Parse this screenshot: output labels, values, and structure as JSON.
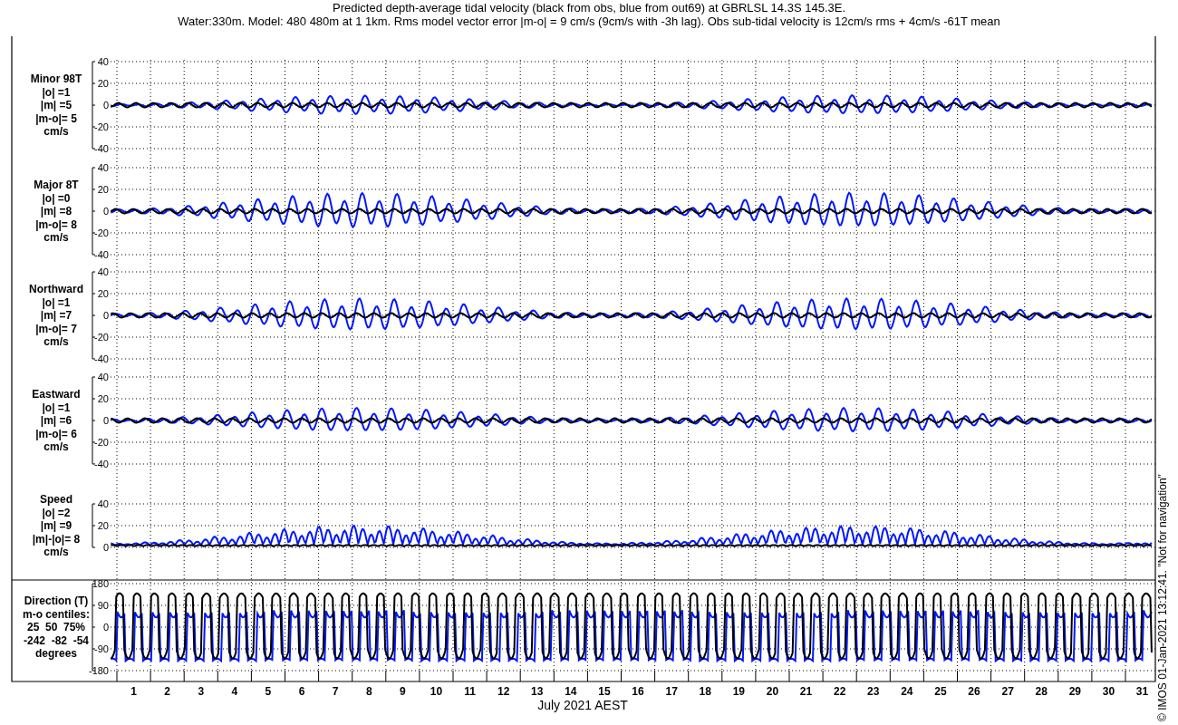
{
  "title": [
    "Predicted depth-average tidal velocity (black from obs, blue from out69) at GBRLSL 14.3S 145.3E.",
    "Water:330m. Model: 480 480m at 1 1km. Rms model vector error |m-o| = 9 cm/s (9cm/s with -3h lag). Obs sub-tidal velocity is 12cm/s rms + 4cm/s -61T mean"
  ],
  "panels": [
    {
      "kind": "velocity",
      "label": [
        "Minor 98T",
        "|o| =1",
        "|m| =5",
        "|m-o|= 5",
        "cm/s"
      ],
      "yticks": [
        "40",
        "20",
        "0",
        "-20",
        "-40"
      ]
    },
    {
      "kind": "velocity",
      "label": [
        "Major 8T",
        "|o| =0",
        "|m| =8",
        "|m-o|= 8",
        "cm/s"
      ],
      "yticks": [
        "40",
        "20",
        "0",
        "-20",
        "-40"
      ]
    },
    {
      "kind": "velocity",
      "label": [
        "Northward",
        "|o| =1",
        "|m| =7",
        "|m-o|= 7",
        "cm/s"
      ],
      "yticks": [
        "40",
        "20",
        "0",
        "-20",
        "-40"
      ]
    },
    {
      "kind": "velocity",
      "label": [
        "Eastward",
        "|o| =1",
        "|m| =6",
        "|m-o|= 6",
        "cm/s"
      ],
      "yticks": [
        "40",
        "20",
        "0",
        "-20",
        "-40"
      ]
    },
    {
      "kind": "speed",
      "label": [
        "Speed",
        "|o| =2",
        "|m| =9",
        "|m|-|o|= 8",
        "cm/s"
      ],
      "yticks": [
        "40",
        "20",
        "0"
      ]
    },
    {
      "kind": "direction",
      "label": [
        "Direction (T)",
        "m-o centiles:",
        "25  50  75%",
        "-242  -82  -54",
        "degrees"
      ],
      "yticks": [
        "180",
        "90",
        "0",
        "-90",
        "-180"
      ]
    }
  ],
  "xaxis": {
    "ticks": [
      "1",
      "2",
      "3",
      "4",
      "5",
      "6",
      "7",
      "8",
      "9",
      "10",
      "11",
      "12",
      "13",
      "14",
      "15",
      "16",
      "17",
      "18",
      "19",
      "20",
      "21",
      "22",
      "23",
      "24",
      "25",
      "26",
      "27",
      "28",
      "29",
      "30",
      "31"
    ],
    "label": "July 2021 AEST"
  },
  "credit": "© IMOS 01-Jan-2021 13:12:41. \"Not for navigation\""
}
